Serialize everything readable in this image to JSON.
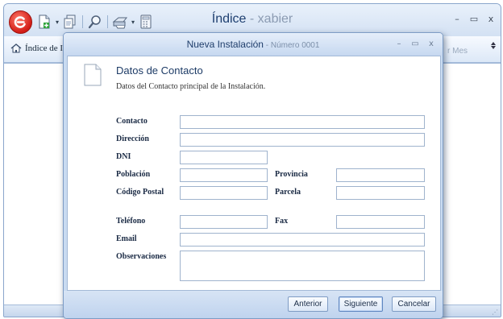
{
  "app": {
    "title": "Índice",
    "title_separator": " - ",
    "subtitle": "xabier",
    "controls": {
      "minimize": "–",
      "restore": "▭",
      "close": "x"
    }
  },
  "ribbon": {
    "tab_label": "Índice de I",
    "right_label": "r Mes"
  },
  "quick_access": {
    "icons": [
      "new-document-icon",
      "copy-document-icon",
      "search-icon",
      "print-icon",
      "calculator-icon"
    ]
  },
  "dialog": {
    "title": "Nueva Instalación",
    "title_separator": " - ",
    "subtitle": "Número 0001",
    "controls": {
      "minimize": "–",
      "restore": "▭",
      "close": "x"
    },
    "section_title": "Datos de Contacto",
    "section_description": "Datos del Contacto principal de la Instalación.",
    "fields": {
      "contacto": {
        "label": "Contacto",
        "value": ""
      },
      "direccion": {
        "label": "Dirección",
        "value": ""
      },
      "dni": {
        "label": "DNI",
        "value": ""
      },
      "poblacion": {
        "label": "Población",
        "value": ""
      },
      "provincia": {
        "label": "Provincia",
        "value": ""
      },
      "codigo_postal": {
        "label": "Código Postal",
        "value": ""
      },
      "parcela": {
        "label": "Parcela",
        "value": ""
      },
      "telefono": {
        "label": "Teléfono",
        "value": ""
      },
      "fax": {
        "label": "Fax",
        "value": ""
      },
      "email": {
        "label": "Email",
        "value": ""
      },
      "observaciones": {
        "label": "Observaciones",
        "value": ""
      }
    },
    "buttons": {
      "previous": "Anterior",
      "next": "Siguiente",
      "cancel": "Cancelar"
    }
  },
  "colors": {
    "accent": "#1e3f70",
    "window_frame": "#c9dbf1",
    "logo_red": "#d21c16"
  }
}
